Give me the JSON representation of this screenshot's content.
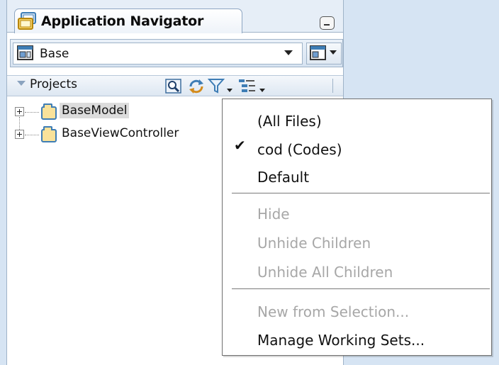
{
  "navigator": {
    "title": "Application Navigator",
    "icons": {
      "app_icon": "application-navigator-icon",
      "minimize": "minimize-icon"
    }
  },
  "application_selector": {
    "value": "Base",
    "icon": "application-icon",
    "dropdown_icon": "chevron-down-icon",
    "menu_icon": "application-menu-icon"
  },
  "projects": {
    "label": "Projects",
    "toolbar": [
      "search-icon",
      "refresh-icon",
      "filter-icon",
      "sort-options-icon"
    ]
  },
  "tree": {
    "items": [
      {
        "label": "BaseModel",
        "icon": "folder-icon",
        "selected": true
      },
      {
        "label": "BaseViewController",
        "icon": "folder-icon",
        "selected": false
      }
    ]
  },
  "filter_menu": {
    "items": [
      {
        "label": "(All Files)",
        "enabled": true,
        "checked": false
      },
      {
        "label": "cod (Codes)",
        "enabled": true,
        "checked": true
      },
      {
        "label": "Default",
        "enabled": true,
        "checked": false
      },
      {
        "label": "Hide",
        "enabled": false,
        "checked": false
      },
      {
        "label": "Unhide Children",
        "enabled": false,
        "checked": false
      },
      {
        "label": "Unhide All Children",
        "enabled": false,
        "checked": false
      },
      {
        "label": "New from Selection...",
        "enabled": false,
        "checked": false
      },
      {
        "label": "Manage Working Sets...",
        "enabled": true,
        "checked": false
      }
    ],
    "check_glyph": "✔"
  }
}
